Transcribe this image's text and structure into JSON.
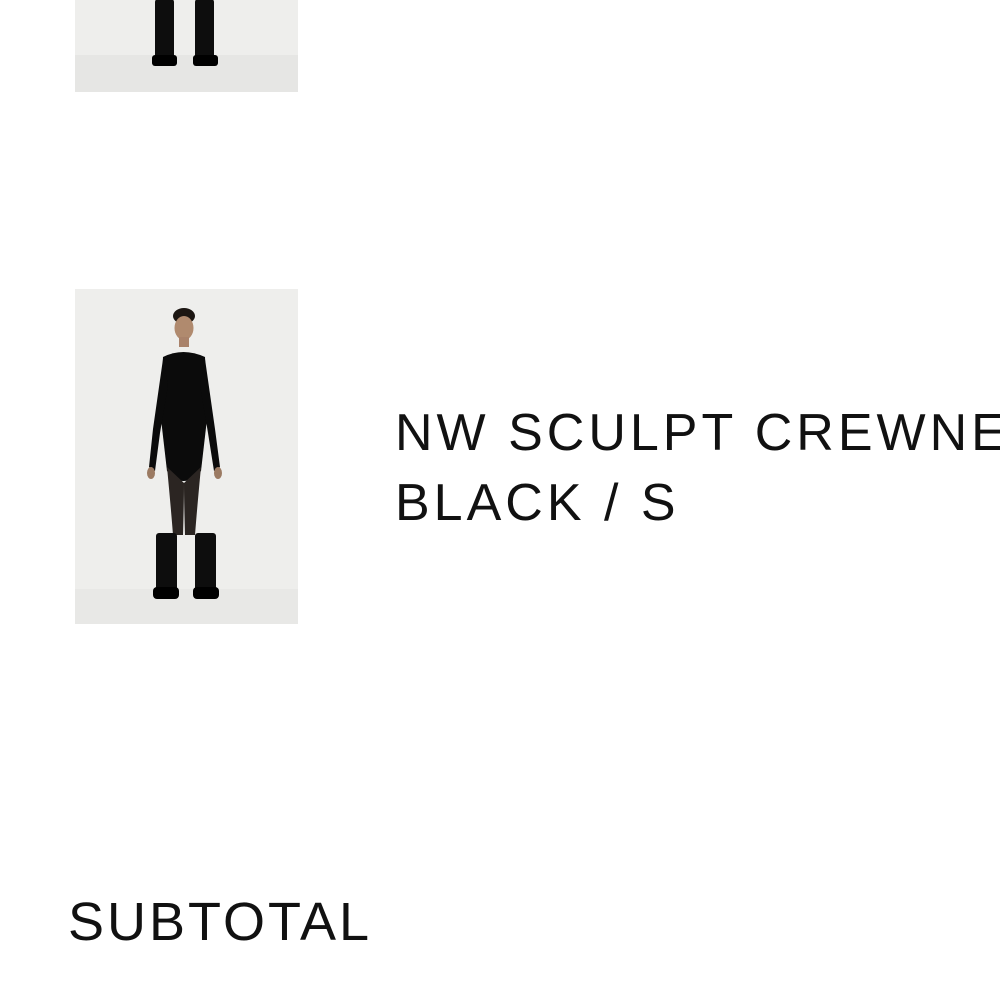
{
  "cart": {
    "items": [
      {
        "image": "model-in-black-bodysuit-and-tights"
      },
      {
        "name": "NW SCULPT CREWNECK",
        "variant": "BLACK / S",
        "image": "model-in-black-bodysuit-and-tights"
      }
    ]
  },
  "summary": {
    "subtotal_label": "SUBTOTAL"
  },
  "colors": {
    "background": "#ffffff",
    "text": "#111111",
    "image_backdrop": "#eeeeec",
    "garment": "#0b0b0b"
  }
}
